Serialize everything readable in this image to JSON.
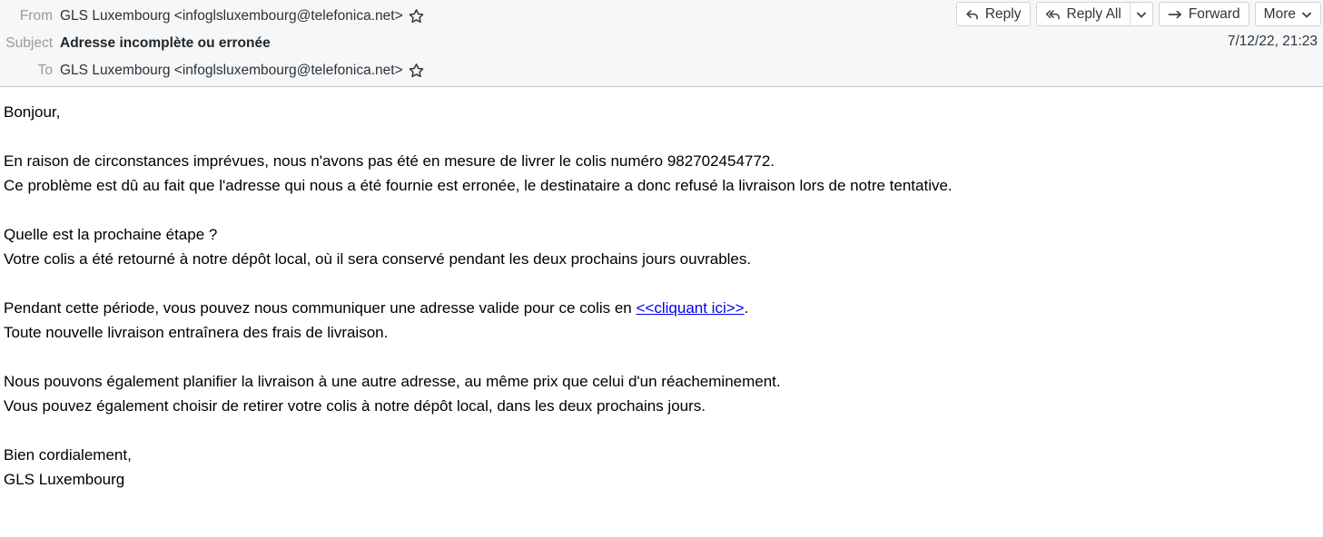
{
  "header": {
    "rows": [
      {
        "label": "From",
        "value": "GLS Luxembourg <infoglsluxembourg@telefonica.net>",
        "star": "star-icon"
      },
      {
        "label": "Subject",
        "value": "Adresse incomplète ou erronée"
      },
      {
        "label": "To",
        "value": "GLS Luxembourg <infoglsluxembourg@telefonica.net>",
        "star": "star-icon"
      }
    ],
    "date": "7/12/22, 21:23"
  },
  "toolbar": {
    "reply_label": "Reply",
    "reply_icon": "reply-arrow-icon",
    "reply_all_label": "Reply All",
    "reply_all_icon": "reply-all-arrow-icon",
    "reply_all_caret_icon": "chevron-down-icon",
    "forward_label": "Forward",
    "forward_icon": "forward-arrow-icon",
    "more_label": "More",
    "more_caret_icon": "chevron-down-icon"
  },
  "body": {
    "greeting": "Bonjour,",
    "para1_line1": "En raison de circonstances imprévues, nous n'avons pas été en mesure de livrer le colis numéro 982702454772.",
    "para1_line2": "Ce problème est dû au fait que l'adresse qui nous a été fournie est erronée, le destinataire a donc refusé la livraison lors de notre tentative.",
    "para2_line1": "Quelle est la prochaine étape ?",
    "para2_line2": "Votre colis a été retourné à notre dépôt local, où il sera conservé pendant les deux prochains jours ouvrables.",
    "para3_prefix": "Pendant cette période, vous pouvez nous communiquer une adresse valide pour ce colis en ",
    "para3_link": "<<cliquant ici>>",
    "para3_suffix": ".",
    "para3_line2": "Toute nouvelle livraison entraînera des frais de livraison.",
    "para4_line1": "Nous pouvons également planifier la livraison à une autre adresse, au même prix que celui d'un réacheminement.",
    "para4_line2": "Vous pouvez également choisir de retirer votre colis à notre dépôt local, dans les deux prochains jours.",
    "signoff_line1": "Bien cordialement,",
    "signoff_line2": "GLS Luxembourg"
  },
  "colors": {
    "link": "#0000ee",
    "header_bg": "#f7f7f7",
    "label_text": "#9a9a9a",
    "body_text": "#000000"
  }
}
